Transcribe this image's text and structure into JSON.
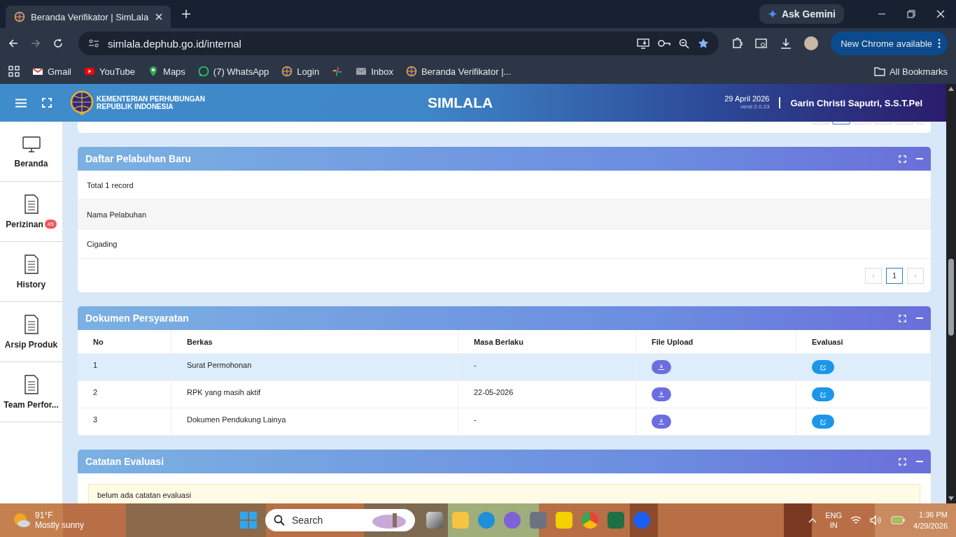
{
  "browser": {
    "tabs": [
      {
        "title": "Beranda Verifikator | SimLala",
        "selected": true
      }
    ],
    "url": "simlala.dephub.go.id/internal",
    "gemini": "Ask Gemini",
    "update": "New Chrome available",
    "bookmarks": [
      {
        "kind": "mail",
        "label": "Gmail"
      },
      {
        "kind": "video",
        "label": "YouTube"
      },
      {
        "kind": "pin",
        "label": "Maps"
      },
      {
        "kind": "chat",
        "label": "(7) WhatsApp"
      },
      {
        "kind": "globe",
        "label": "Login"
      },
      {
        "kind": "pinwheel"
      },
      {
        "kind": "envelope",
        "label": "Inbox"
      },
      {
        "kind": "globe",
        "label": "Beranda Verifikator |..."
      }
    ],
    "all_bookmarks": "All Bookmarks"
  },
  "header": {
    "org_line1": "KEMENTERIAN PERHUBUNGAN",
    "org_line2": "REPUBLIK INDONESIA",
    "title": "SIMLALA",
    "date": "29 April 2026",
    "version": "versi 2.0.23",
    "user": "Garin Christi Saputri, S.S.T.Pel"
  },
  "sidebar": {
    "items": [
      {
        "label": "Beranda",
        "kind": "monitor"
      },
      {
        "label": "Perizinan",
        "kind": "doc",
        "badge": "45"
      },
      {
        "label": "History",
        "kind": "doc"
      },
      {
        "label": "Arsip Produk",
        "kind": "doc"
      },
      {
        "label": "Team Perfor...",
        "kind": "doc"
      }
    ]
  },
  "port_card": {
    "title": "Daftar Pelabuhan Baru",
    "total": "Total 1 record",
    "column": "Nama Pelabuhan",
    "rows": [
      "Cigading"
    ],
    "pagination": [
      {
        "label": "‹",
        "disabled": true,
        "selected": false
      },
      {
        "label": "1",
        "disabled": false,
        "selected": true
      },
      {
        "label": "›",
        "disabled": true,
        "selected": false
      }
    ]
  },
  "documents_card": {
    "title": "Dokumen Persyaratan",
    "columns": [
      "No",
      "Berkas",
      "Masa Berlaku",
      "File Upload",
      "Evaluasi"
    ],
    "rows": [
      {
        "no": "1",
        "berkas": "Surat Permohonan",
        "masa_berlaku": "-",
        "selected": true
      },
      {
        "no": "2",
        "berkas": "RPK yang masih aktif",
        "masa_berlaku": "22-05-2026",
        "selected": false
      },
      {
        "no": "3",
        "berkas": "Dokumen Pendukung Lainya",
        "masa_berlaku": "-",
        "selected": false
      }
    ]
  },
  "notes_card": {
    "title": "Catatan Evaluasi",
    "message": "belum ada catatan evaluasi"
  },
  "taskbar": {
    "temperature": "91°F",
    "weather": "Mostly sunny",
    "search": "Search",
    "language": "ENG",
    "region": "IN",
    "time": "1:36 PM",
    "date": "4/29/2026"
  }
}
